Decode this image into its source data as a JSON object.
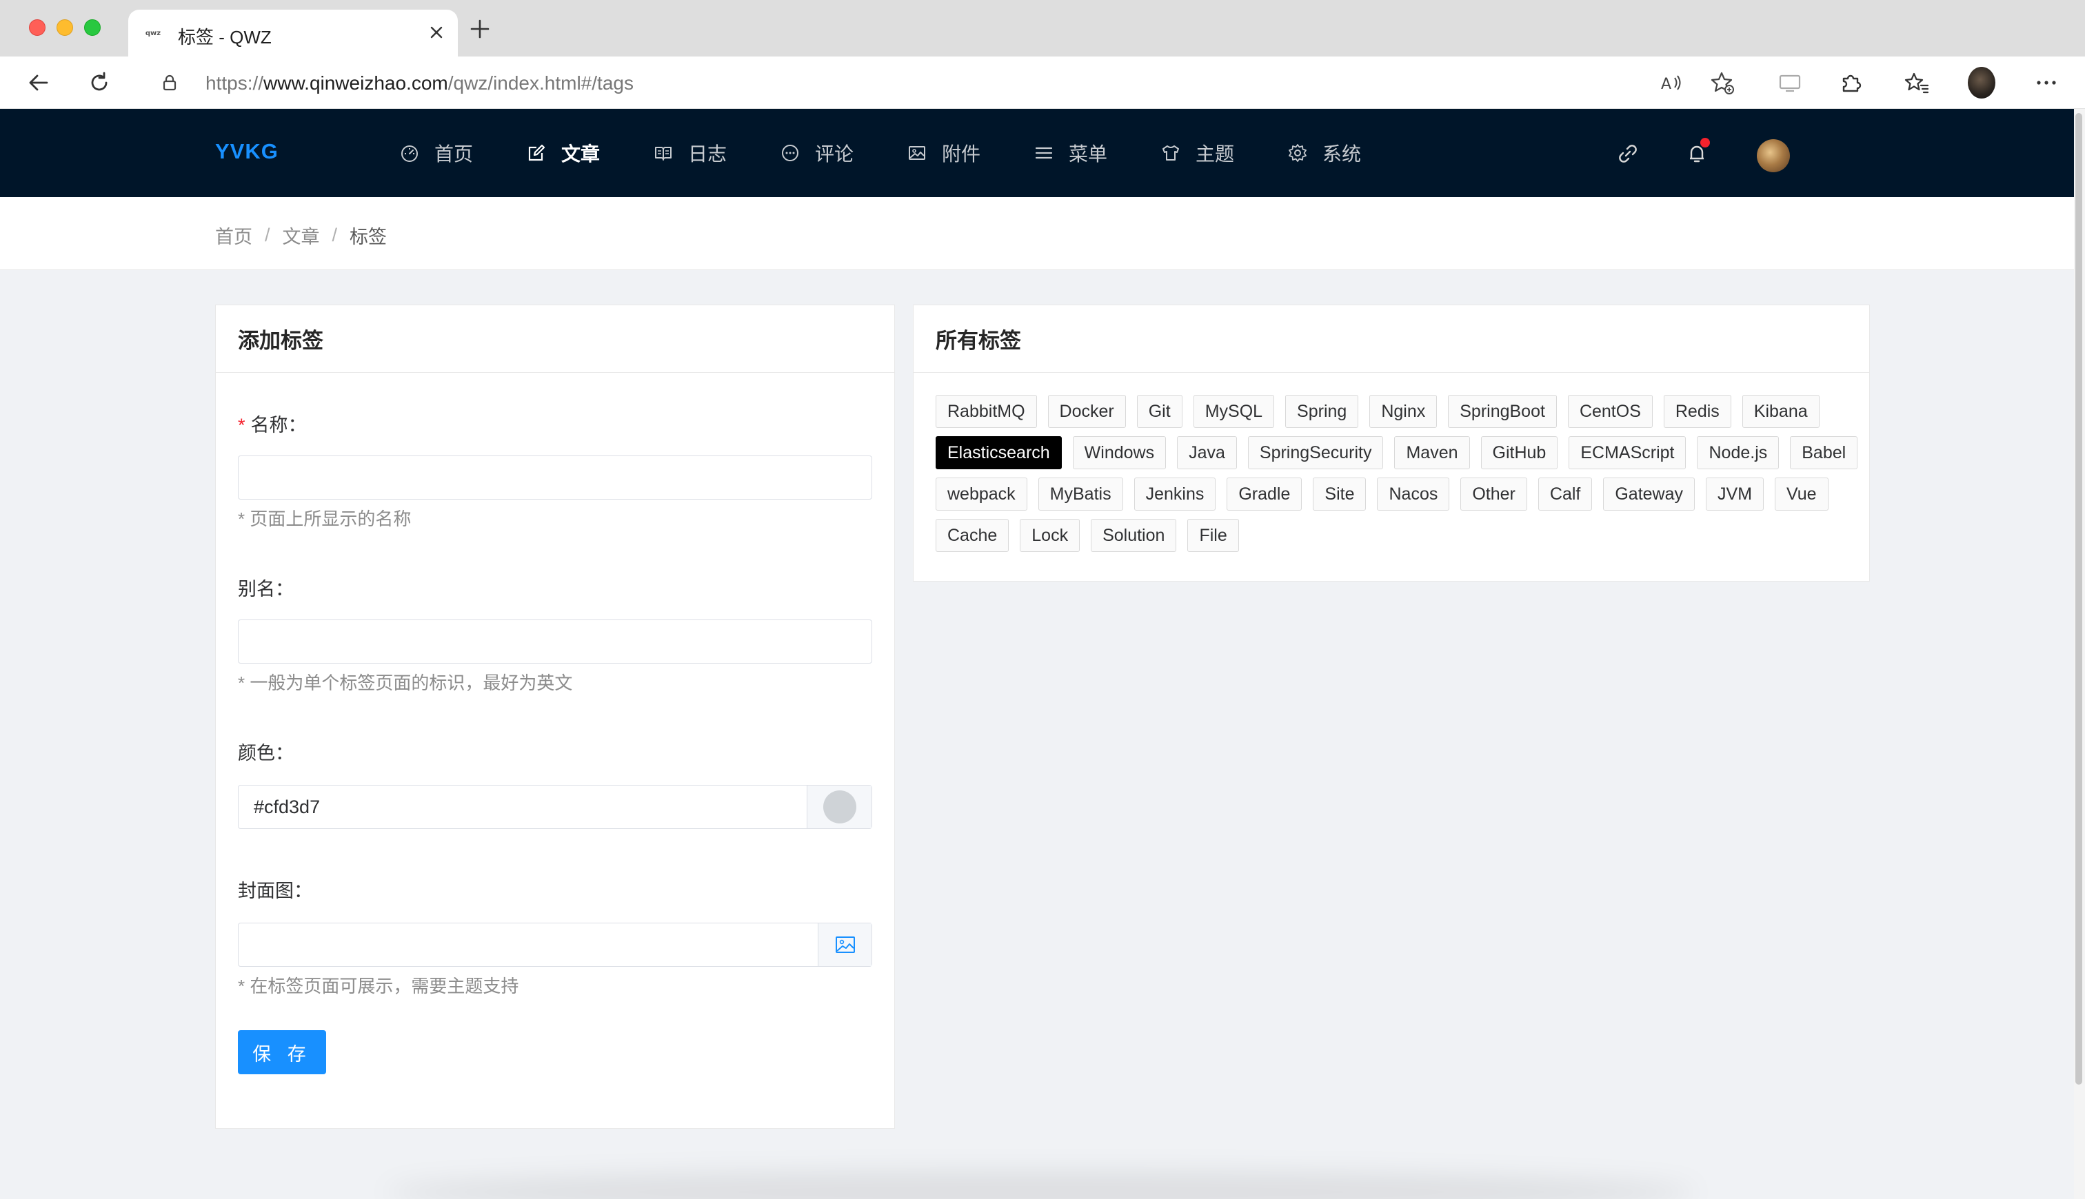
{
  "browser": {
    "tab_title": "标签 - QWZ",
    "favicon_text": "qwz",
    "url_prefix": "https://",
    "url_host": "www.qinweizhao.com",
    "url_path": "/qwz/index.html#/tags"
  },
  "header": {
    "logo": "YVKG",
    "nav": [
      {
        "label": "首页",
        "icon": "dashboard-icon"
      },
      {
        "label": "文章",
        "icon": "edit-icon"
      },
      {
        "label": "日志",
        "icon": "book-icon"
      },
      {
        "label": "评论",
        "icon": "message-icon"
      },
      {
        "label": "附件",
        "icon": "picture-icon"
      },
      {
        "label": "菜单",
        "icon": "menu-icon"
      },
      {
        "label": "主题",
        "icon": "skin-icon"
      },
      {
        "label": "系统",
        "icon": "setting-icon"
      }
    ],
    "active_nav": "文章"
  },
  "breadcrumb": {
    "items": [
      "首页",
      "文章",
      "标签"
    ],
    "separator": "/"
  },
  "form": {
    "title": "添加标签",
    "name_label": "名称：",
    "name_required_mark": "*",
    "name_value": "",
    "name_help": "* 页面上所显示的名称",
    "slug_label": "别名：",
    "slug_value": "",
    "slug_help": "* 一般为单个标签页面的标识，最好为英文",
    "color_label": "颜色：",
    "color_value": "#cfd3d7",
    "cover_label": "封面图：",
    "cover_value": "",
    "cover_help": "* 在标签页面可展示，需要主题支持",
    "save_label": "保 存"
  },
  "tags_panel": {
    "title": "所有标签",
    "selected": "Elasticsearch",
    "tags": [
      "RabbitMQ",
      "Docker",
      "Git",
      "MySQL",
      "Spring",
      "Nginx",
      "SpringBoot",
      "CentOS",
      "Redis",
      "Kibana",
      "Elasticsearch",
      "Windows",
      "Java",
      "SpringSecurity",
      "Maven",
      "GitHub",
      "ECMAScript",
      "Node.js",
      "Babel",
      "webpack",
      "MyBatis",
      "Jenkins",
      "Gradle",
      "Site",
      "Nacos",
      "Other",
      "Calf",
      "Gateway",
      "JVM",
      "Vue",
      "Cache",
      "Lock",
      "Solution",
      "File"
    ]
  },
  "colors": {
    "header_bg": "#001529",
    "accent": "#1890ff",
    "selected_tag_bg": "#000000",
    "color_swatch": "#cfd3d7",
    "notification_dot": "#f5222d"
  }
}
